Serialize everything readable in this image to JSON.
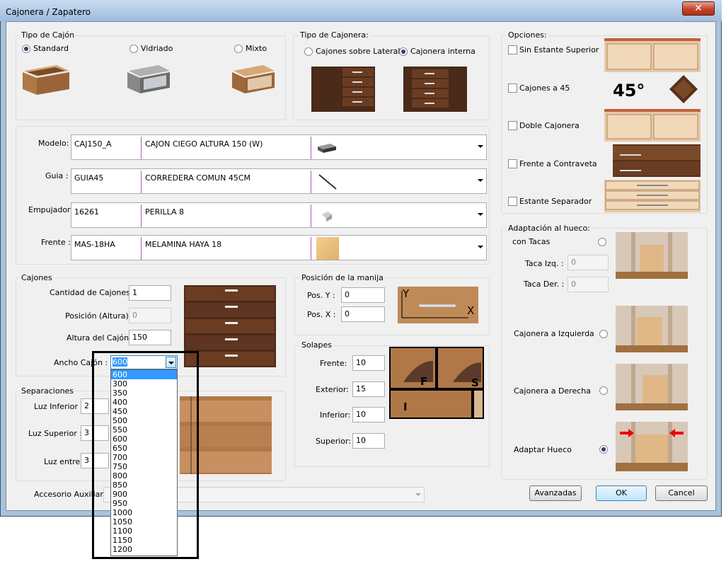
{
  "window": {
    "title": "Cajonera / Zapatero",
    "close": "✕"
  },
  "tipo_cajon": {
    "label": "Tipo de Cajón",
    "options": [
      "Standard",
      "Vidriado",
      "Mixto"
    ]
  },
  "tipo_cajonera": {
    "label": "Tipo de Cajonera:",
    "options": [
      "Cajones sobre Lateral",
      "Cajonera interna"
    ]
  },
  "opciones": {
    "label": "Opciones:",
    "items": [
      "Sin Estante Superior",
      "Cajones a 45",
      "Doble Cajonera",
      "Frente a Contraveta",
      "Estante Separador"
    ],
    "angle_text": "45°"
  },
  "combos": [
    {
      "label": "Modelo:",
      "code": "CAJ150_A",
      "desc": "CAJON CIEGO ALTURA 150 (W)"
    },
    {
      "label": "Guia :",
      "code": "GUIA45",
      "desc": "CORREDERA COMUN 45CM"
    },
    {
      "label": "Empujador:",
      "code": "16261",
      "desc": "PERILLA 8"
    },
    {
      "label": "Frente :",
      "code": "MAS-18HA",
      "desc": "MELAMINA HAYA 18"
    }
  ],
  "cajones": {
    "label": "Cajones",
    "cantidad_label": "Cantidad de Cajones :",
    "cantidad": "1",
    "posicion_label": "Posición (Altura) :",
    "posicion": "0",
    "altura_label": "Altura del Cajón :",
    "altura": "150",
    "ancho_label": "Ancho Cajón :",
    "ancho": "600"
  },
  "separaciones": {
    "label": "Separaciones",
    "inferior_label": "Luz Inferior :",
    "inferior": "2",
    "superior_label": "Luz Superior :",
    "superior": "3",
    "entre_label": "Luz entre",
    "entre": "3"
  },
  "accesorio_label": "Accesorio Auxiliar",
  "manija": {
    "label": "Posición de la manija",
    "posy_label": "Pos. Y :",
    "posy": "0",
    "posx_label": "Pos. X :",
    "posx": "0",
    "axis_y": "Y",
    "axis_x": "X"
  },
  "solapes": {
    "label": "Solapes",
    "frente_label": "Frente:",
    "frente": "10",
    "exterior_label": "Exterior:",
    "exterior": "15",
    "inferior_label": "Inferior:",
    "inferior": "10",
    "superior_label": "Superior:",
    "superior": "10",
    "letters": [
      "F",
      "S",
      "I"
    ]
  },
  "adaptacion": {
    "label": "Adaptación al hueco:",
    "con_tacas": "con Tacas",
    "taca_izq_label": "Taca Izq. :",
    "taca_izq": "0",
    "taca_der_label": "Taca Der. :",
    "taca_der": "0",
    "izquierda": "Cajonera a Izquierda",
    "derecha": "Cajonera a Derecha",
    "adaptar": "Adaptar Hueco"
  },
  "buttons": {
    "avanzadas": "Avanzadas",
    "ok": "OK",
    "cancel": "Cancel"
  },
  "dropdown_options": [
    "600",
    "300",
    "350",
    "400",
    "450",
    "500",
    "550",
    "600",
    "650",
    "700",
    "750",
    "800",
    "850",
    "900",
    "950",
    "1000",
    "1050",
    "1100",
    "1150",
    "1200"
  ],
  "colors": {
    "wood_dark": "#4a2a18",
    "wood_light": "#c08a58",
    "highlight": "#3399ff"
  }
}
